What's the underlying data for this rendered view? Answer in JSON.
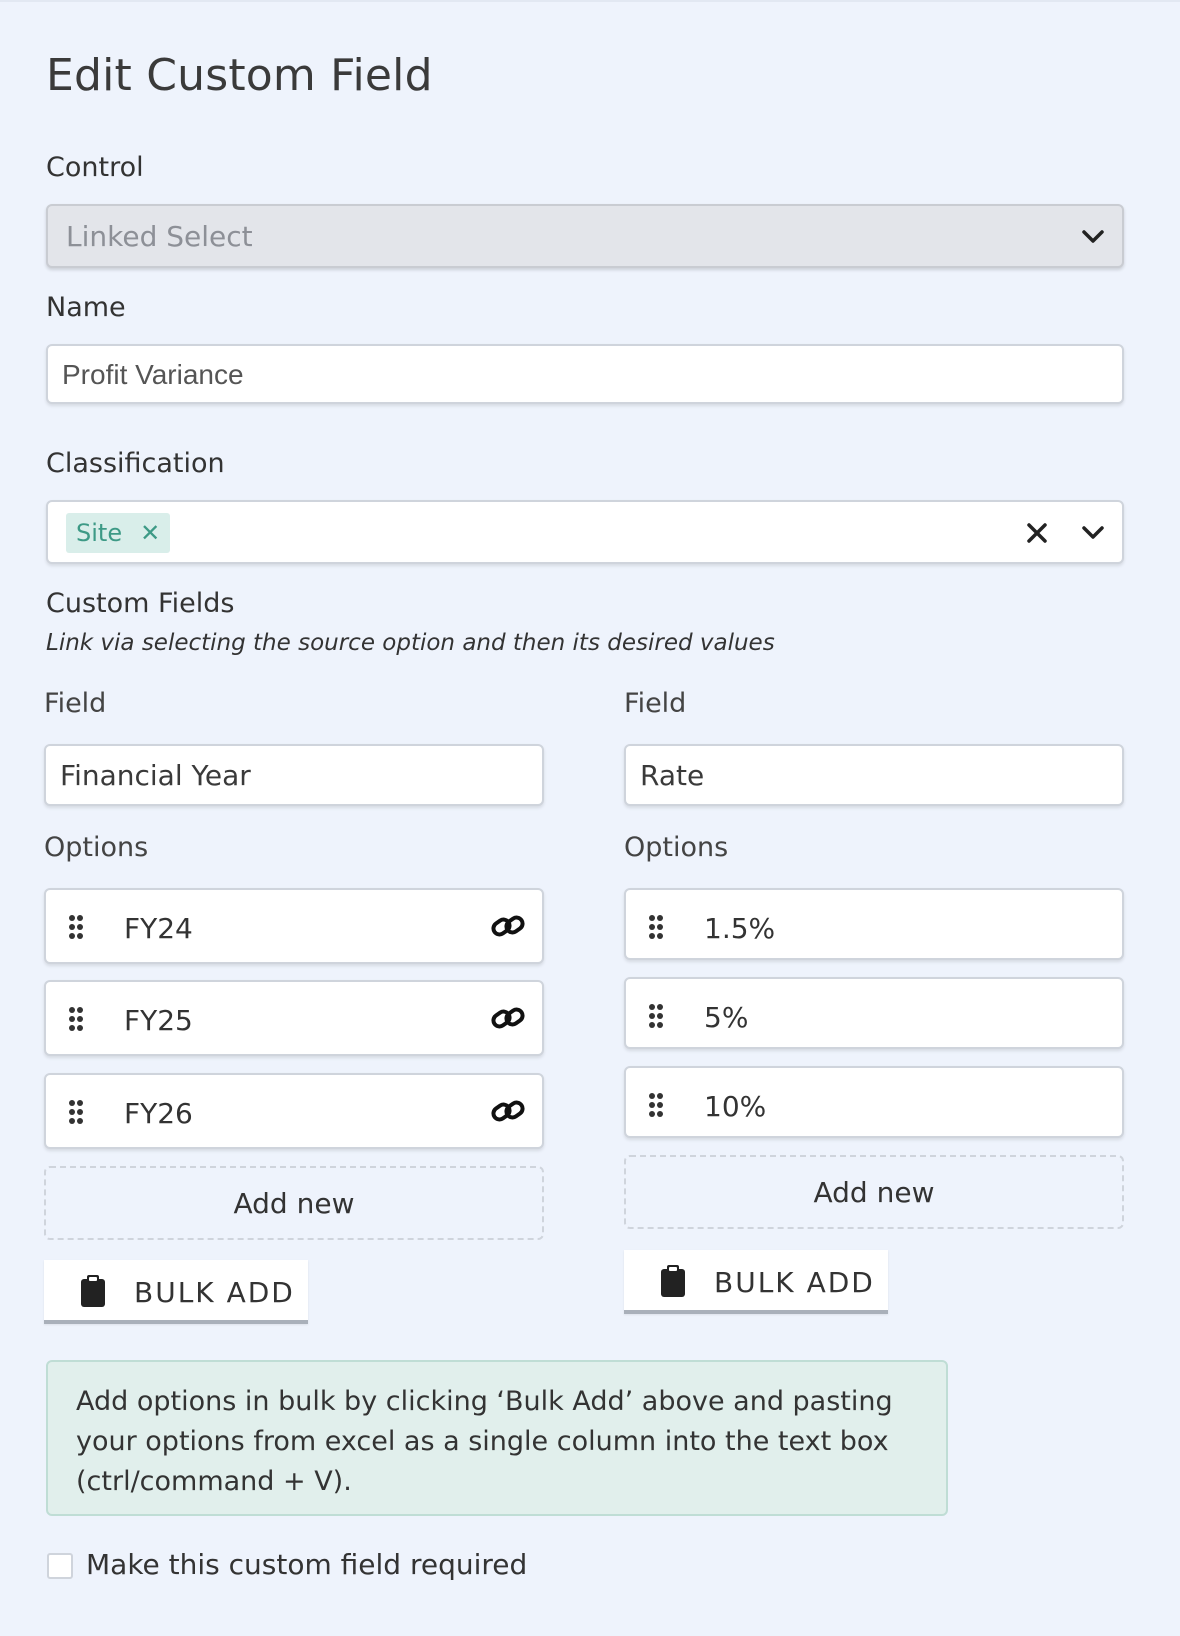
{
  "page": {
    "title": "Edit Custom Field"
  },
  "control": {
    "label": "Control",
    "value": "Linked Select"
  },
  "name": {
    "label": "Name",
    "value": "Profit Variance"
  },
  "classification": {
    "label": "Classification",
    "tags": [
      "Site"
    ]
  },
  "custom_fields": {
    "heading": "Custom Fields",
    "subtitle": "Link via selecting the source option and then its desired values",
    "columns": [
      {
        "field_label": "Field",
        "field_value": "Financial Year",
        "options_label": "Options",
        "options": [
          "FY24",
          "FY25",
          "FY26"
        ],
        "add_new_label": "Add new",
        "bulk_add_label": "BULK ADD"
      },
      {
        "field_label": "Field",
        "field_value": "Rate",
        "options_label": "Options",
        "options": [
          "1.5%",
          "5%",
          "10%"
        ],
        "add_new_label": "Add new",
        "bulk_add_label": "BULK ADD"
      }
    ]
  },
  "bulk_note": {
    "text": "Add options in bulk by clicking ‘Bulk Add’ above and pasting your options from excel as a single column into the text box (ctrl/command + V)."
  },
  "required": {
    "label": "Make this custom field required",
    "checked": false
  },
  "icons": {
    "chevron": "chevron-down-icon",
    "clear": "close-icon",
    "tag_remove": "tag-remove-icon",
    "drag": "drag-handle-icon",
    "link": "link-icon",
    "clipboard": "clipboard-icon"
  },
  "colors": {
    "background": "#eef3fc",
    "tag_bg": "#d9eeea",
    "tag_text": "#3d9a86",
    "note_bg": "#e1efec"
  }
}
